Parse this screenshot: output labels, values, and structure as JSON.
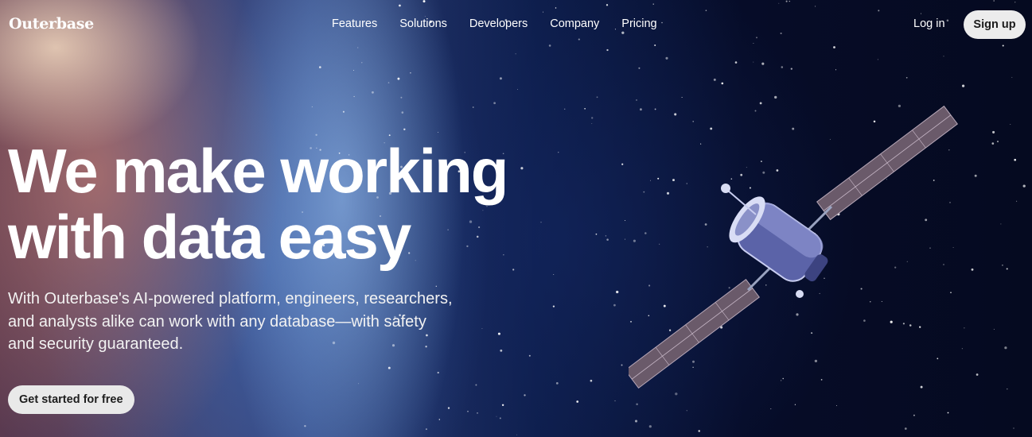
{
  "brand": {
    "logo_text": "Outerbase"
  },
  "nav": {
    "items": [
      {
        "label": "Features"
      },
      {
        "label": "Solutions"
      },
      {
        "label": "Developers"
      },
      {
        "label": "Company"
      },
      {
        "label": "Pricing"
      }
    ],
    "login_label": "Log in",
    "signup_label": "Sign up"
  },
  "hero": {
    "headline_lines": [
      "We make working",
      "with data easy"
    ],
    "subtext_lines": [
      "With Outerbase's AI-powered platform, engineers, researchers,",
      "and analysts alike can work with any database—with safety",
      "and security guaranteed."
    ],
    "cta_label": "Get started for free",
    "image": "satellite-in-space-icon"
  },
  "colors": {
    "text": "#ffffff",
    "button_bg": "#ececec",
    "button_text": "#1b1b1b",
    "space_dark": "#050a20",
    "planet_glow": "#aad2ff"
  }
}
